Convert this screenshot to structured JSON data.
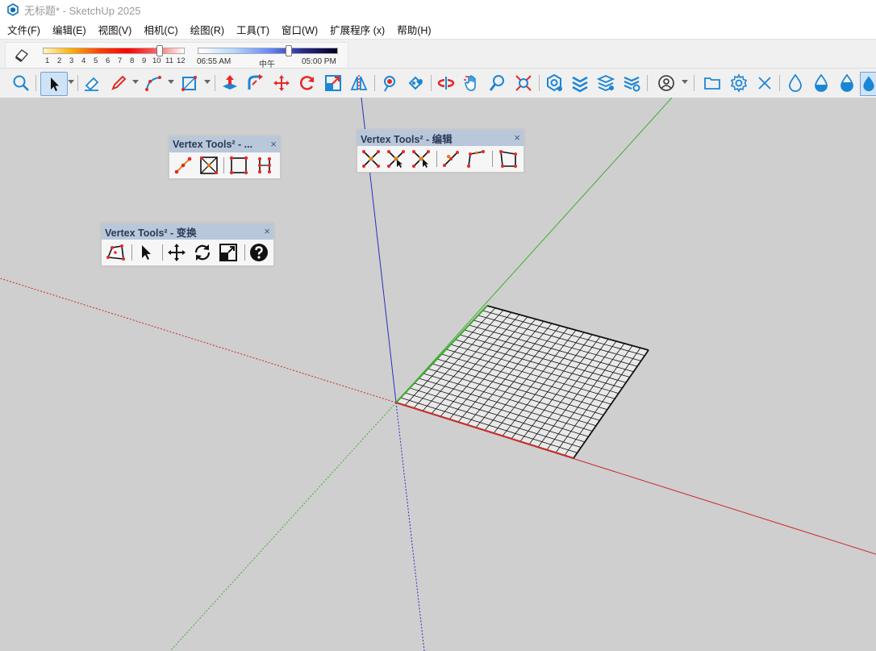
{
  "window": {
    "title": "无标题* - SketchUp 2025"
  },
  "menu": [
    "文件(F)",
    "编辑(E)",
    "视图(V)",
    "相机(C)",
    "绘图(R)",
    "工具(T)",
    "窗口(W)",
    "扩展程序 (x)",
    "帮助(H)"
  ],
  "shadows": {
    "months": [
      "1",
      "2",
      "3",
      "4",
      "5",
      "6",
      "7",
      "8",
      "9",
      "10",
      "11",
      "12"
    ],
    "time_start": "06:55 AM",
    "time_mid": "中午",
    "time_end": "05:00 PM"
  },
  "palettes": {
    "p1": {
      "title": "Vertex Tools² - ..."
    },
    "p2": {
      "title": "Vertex Tools² - 编辑"
    },
    "p3": {
      "title": "Vertex Tools² - 变换"
    },
    "close": "×"
  },
  "colors": {
    "axis_red": "#cc2a2a",
    "axis_green": "#3fae2f",
    "axis_blue": "#2d2dbf",
    "toolbar_blue": "#1a86d6",
    "tool_red": "#e52828"
  }
}
